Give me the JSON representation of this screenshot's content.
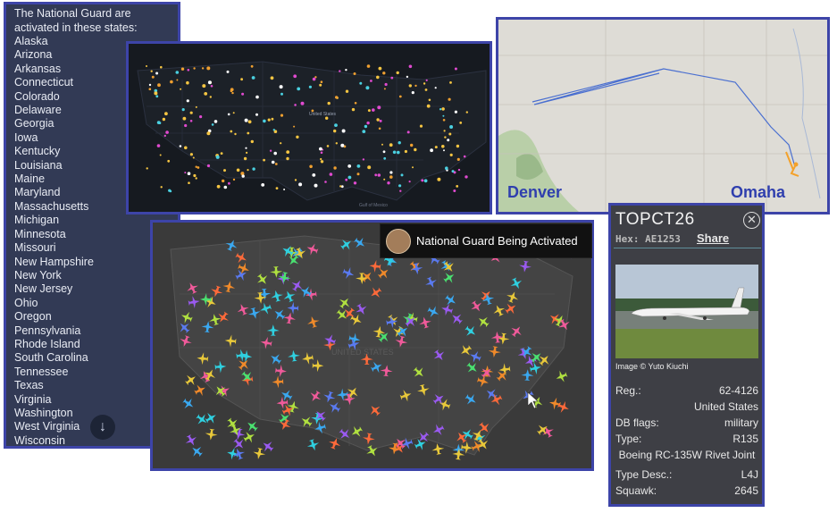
{
  "states_panel": {
    "intro": "The National Guard are activated in these states:",
    "states": [
      "Alaska",
      "Arizona",
      "Arkansas",
      "Connecticut",
      "Colorado",
      "Delaware",
      "Georgia",
      "Iowa",
      "Kentucky",
      "Louisiana",
      "Maine",
      "Maryland",
      "Massachusetts",
      "Michigan",
      "Minnesota",
      "Missouri",
      "New Hampshire",
      "New York",
      "New Jersey",
      "Ohio",
      "Oregon",
      "Pennsylvania",
      "Rhode Island",
      "South Carolina",
      "Tennessee",
      "Texas",
      "Virginia",
      "Washington",
      "West Virginia",
      "Wisconsin"
    ],
    "scroll_icon": "arrow-down-icon"
  },
  "night_map": {
    "label_us": "United States",
    "label_gulf": "Gulf of Mexico"
  },
  "route_map": {
    "city_west": "Denver",
    "city_east": "Omaha",
    "route_color": "#4a6fd0"
  },
  "flights_map": {
    "banner_text": "National Guard Being Activated",
    "map_label": "UNITED STATES"
  },
  "aircraft_card": {
    "callsign": "TOPCT26",
    "hex": "Hex: AE1253",
    "share": "Share",
    "photo_credit": "Image © Yuto Kiuchi",
    "reg_label": "Reg.:",
    "reg_value": "62-4126",
    "country": "United States",
    "db_flags_label": "DB flags:",
    "db_flags_value": "military",
    "type_label": "Type:",
    "type_value": "R135",
    "type_name": "Boeing RC-135W Rivet Joint",
    "type_desc_label": "Type Desc.:",
    "type_desc_value": "L4J",
    "squawk_label": "Squawk:",
    "squawk_value": "2645"
  },
  "colors": {
    "border": "#3d44a8",
    "panel_bg": "#323a55",
    "card_bg": "#3e3f45"
  }
}
